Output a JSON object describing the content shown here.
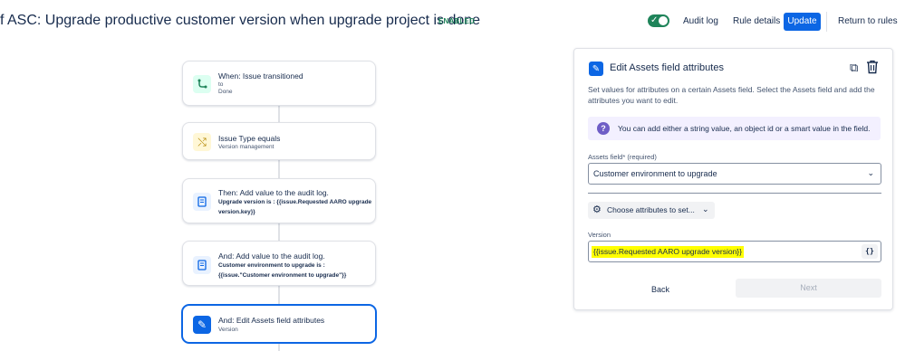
{
  "header": {
    "title": "f ASC: Upgrade productive customer version when upgrade project is done",
    "status_badge": "ENABLED",
    "toggle_on": true,
    "audit_log": "Audit log",
    "rule_details": "Rule details",
    "update": "Update",
    "return_to_rules": "Return to rules"
  },
  "flow": {
    "nodes": [
      {
        "title": "When: Issue transitioned",
        "line2": "to",
        "line3": "Done",
        "icon": "transition-icon"
      },
      {
        "title": "Issue Type equals",
        "subtitle": "Version management",
        "icon": "shuffle-icon"
      },
      {
        "title": "Then: Add value to the audit log.",
        "detail": "Upgrade version is : {{issue.Requested AARO upgrade version.key}}",
        "icon": "document-icon"
      },
      {
        "title": "And: Add value to the audit log.",
        "detail": "Customer environment to upgrade is : {{issue.\"Customer environment to upgrade\"}}",
        "icon": "document-icon"
      },
      {
        "title": "And: Edit Assets field attributes",
        "subtitle": "Version",
        "icon": "pencil-icon"
      }
    ]
  },
  "panel": {
    "title": "Edit Assets field attributes",
    "description": "Set values for attributes on a certain Assets field. Select the Assets field and add the attributes you want to edit.",
    "info": "You can add either a string value, an object id or a smart value in the field.",
    "assets_field_label": "Assets field",
    "assets_field_required": "* (required)",
    "assets_field_value": "Customer environment to upgrade",
    "choose_attributes": "Choose attributes to set...",
    "version_label": "Version",
    "version_value": "{{issue.Requested AARO upgrade version}}",
    "smart_value_button": "{}",
    "back": "Back",
    "next": "Next"
  },
  "colors": {
    "primary": "#0c66e4",
    "enabled_green": "#1f845a",
    "highlight": "#ffff00",
    "info_bg": "#f3f0ff"
  }
}
